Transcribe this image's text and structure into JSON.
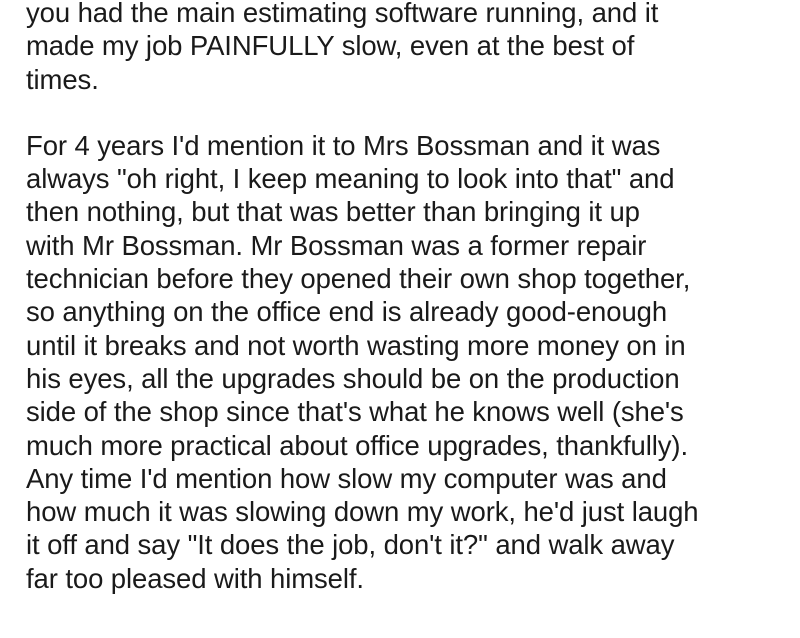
{
  "paragraphs": [
    {
      "lines": [
        "you had the main estimating software running, and it",
        "made my job PAINFULLY slow, even at the best of",
        "times."
      ]
    },
    {
      "lines": [
        "For 4 years I'd mention it to Mrs Bossman and it was",
        "always \"oh right, I keep meaning to look into that\" and",
        "then nothing, but that was better than bringing it up",
        "with Mr Bossman. Mr Bossman was a former repair",
        "technician before they opened their own shop together,",
        "so anything on the office end is already good-enough",
        "until it breaks and not worth wasting more money on in",
        "his eyes, all the upgrades should be on the production",
        "side of the shop since that's what he knows well (she's",
        "much more practical about office upgrades, thankfully).",
        "Any time I'd mention how slow my computer was and",
        "how much it was slowing down my work, he'd just laugh",
        "it off and say \"It does the job, don't it?\" and walk away",
        "far too pleased with himself."
      ]
    }
  ],
  "colors": {
    "text": "#1a1a1a",
    "background": "#ffffff"
  }
}
